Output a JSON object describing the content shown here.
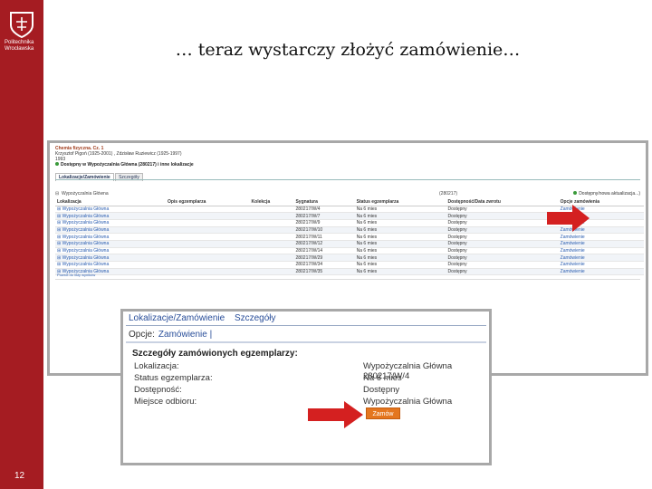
{
  "slide": {
    "title": "… teraz wystarczy złożyć zamówienie…",
    "number": "12",
    "university": [
      "Politechnika",
      "Wrocławska"
    ],
    "brand_color": "#a51c22"
  },
  "catalog": {
    "book_title": "Chemia fizyczna. Cz. 1",
    "authors": "Krzysztof Pigoń (1925-2001) , Zdzisław Ruziewicz (1925-1997)",
    "year": "1993",
    "availability": "Dostępny w Wypożyczalnia Główna (280217) i inne lokalizacje",
    "tabs": [
      "Lokalizacje/Zamówienie",
      "Szczegóły"
    ],
    "location": "Wypożyczalnia Główna",
    "count": "(280217)",
    "update_note": "Dostępny/nowa aktualizacja...)",
    "columns": [
      "Lokalizacja",
      "Opis egzemplarza",
      "Kolekcja",
      "Sygnatura",
      "Status egzemplarza",
      "Dostępność/Data zwrotu",
      "Opcje zamówienia"
    ],
    "rows": [
      {
        "loc": "Wypożyczalnia Główna",
        "sig": "280217/W/4",
        "status": "Na 6 mies",
        "avail": "Dostępny",
        "opt": "Zamówienie"
      },
      {
        "loc": "Wypożyczalnia Główna",
        "sig": "280217/W/7",
        "status": "Na 6 mies",
        "avail": "Dostępny",
        "opt": "Zamówienie"
      },
      {
        "loc": "Wypożyczalnia Główna",
        "sig": "280217/W/9",
        "status": "Na 6 mies",
        "avail": "Dostępny",
        "opt": "Zamówienie"
      },
      {
        "loc": "Wypożyczalnia Główna",
        "sig": "280217/W/10",
        "status": "Na 6 mies",
        "avail": "Dostępny",
        "opt": "Zamówienie"
      },
      {
        "loc": "Wypożyczalnia Główna",
        "sig": "280217/W/11",
        "status": "Na 6 mies",
        "avail": "Dostępny",
        "opt": "Zamówienie"
      },
      {
        "loc": "Wypożyczalnia Główna",
        "sig": "280217/W/12",
        "status": "Na 6 mies",
        "avail": "Dostępny",
        "opt": "Zamówienie"
      },
      {
        "loc": "Wypożyczalnia Główna",
        "sig": "280217/W/14",
        "status": "Na 6 mies",
        "avail": "Dostępny",
        "opt": "Zamówienie"
      },
      {
        "loc": "Wypożyczalnia Główna",
        "sig": "280217/W/29",
        "status": "Na 6 mies",
        "avail": "Dostępny",
        "opt": "Zamówienie"
      },
      {
        "loc": "Wypożyczalnia Główna",
        "sig": "280217/W/34",
        "status": "Na 6 mies",
        "avail": "Dostępny",
        "opt": "Zamówienie"
      },
      {
        "loc": "Wypożyczalnia Główna",
        "sig": "280217/W/35",
        "status": "Na 6 mies",
        "avail": "Dostępny",
        "opt": "Zamówienie"
      }
    ],
    "footer_link": "Powrót do listy wyników"
  },
  "dialog": {
    "tabs": [
      "Lokalizacje/Zamówienie",
      "Szczegóły"
    ],
    "options_label": "Opcje:",
    "options_link": "Zamówienie |",
    "heading": "Szczegóły zamówionych egzemplarzy:",
    "fields": [
      {
        "label": "Lokalizacja:",
        "value": "Wypożyczalnia Główna 280217/W/4"
      },
      {
        "label": "Status egzemplarza:",
        "value": "Na 6 mies"
      },
      {
        "label": "Dostępność:",
        "value": "Dostępny"
      },
      {
        "label": "Miejsce odbioru:",
        "value": "Wypożyczalnia Główna"
      }
    ],
    "order_button": "Zamów",
    "button_color": "#e4761f"
  },
  "arrows": {
    "color": "#d42020"
  }
}
